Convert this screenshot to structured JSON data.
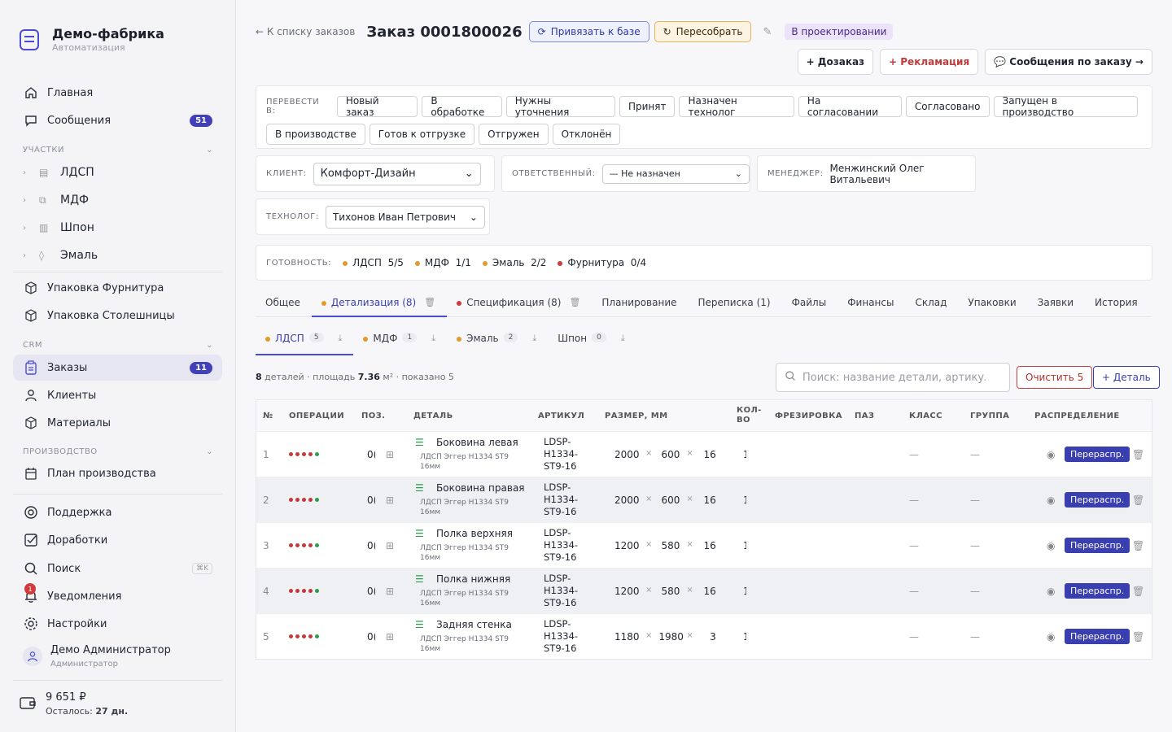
{
  "sidebar": {
    "brand_title": "Демо-фабрика",
    "brand_sub": "Автоматизация",
    "home": "Главная",
    "messages": "Сообщения",
    "messages_badge": "51",
    "section_sites": "УЧАСТКИ",
    "sites": [
      "ЛДСП",
      "МДФ",
      "Шпон",
      "Эмаль"
    ],
    "pack_hardware": "Упаковка Фурнитура",
    "pack_tops": "Упаковка Столешницы",
    "section_crm": "CRM",
    "orders": "Заказы",
    "orders_badge": "11",
    "clients": "Клиенты",
    "materials": "Материалы",
    "section_prod": "ПРОИЗВОДСТВО",
    "plan": "План производства",
    "support": "Поддержка",
    "improvements": "Доработки",
    "search": "Поиск",
    "search_kbd": "⌘K",
    "notifications": "Уведомления",
    "notif_count": "1",
    "settings": "Настройки",
    "user_name": "Демо Администратор",
    "user_role": "Администратор",
    "balance": "9 651 ₽",
    "remaining_label": "Осталось:",
    "remaining_value": "27 дн."
  },
  "header": {
    "back": "← К списку заказов",
    "title": "Заказ 0001800026",
    "bind_btn": "Привязать к базе",
    "rebuild_btn": "Пересобрать",
    "status": "В проектировании",
    "extra_order": "+ Дозаказ",
    "claim": "+ Рекламация",
    "order_messages": "💬 Сообщения по заказу →"
  },
  "transfer": {
    "label": "ПЕРЕВЕСТИ В:",
    "row1": [
      "Новый заказ",
      "В обработке",
      "Нужны уточнения",
      "Принят",
      "Назначен технолог",
      "На согласовании",
      "Согласовано",
      "Запущен в производство"
    ],
    "row2": [
      "В производстве",
      "Готов к отгрузке",
      "Отгружен",
      "Отклонён"
    ]
  },
  "fields": {
    "client_label": "КЛИЕНТ:",
    "client_value": "Комфорт-Дизайн",
    "resp_label": "ОТВЕТСТВЕННЫЙ:",
    "resp_value": "— Не назначен",
    "manager_label": "МЕНЕДЖЕР:",
    "manager_value": "Менжинский Олег Витальевич",
    "tech_label": "ТЕХНОЛОГ:",
    "tech_value": "Тихонов Иван Петрович"
  },
  "readiness": {
    "label": "ГОТОВНОСТЬ:",
    "items": [
      {
        "name": "ЛДСП",
        "value": "5/5",
        "color": "#e39a2a"
      },
      {
        "name": "МДФ",
        "value": "1/1",
        "color": "#e39a2a"
      },
      {
        "name": "Эмаль",
        "value": "2/2",
        "color": "#e39a2a"
      },
      {
        "name": "Фурнитура",
        "value": "0/4",
        "color": "#d23b3b"
      }
    ]
  },
  "tabs": [
    "Общее",
    "Детализация (8)",
    "Спецификация (8)",
    "Планирование",
    "Переписка (1)",
    "Файлы",
    "Финансы",
    "Склад",
    "Упаковки",
    "Заявки",
    "История"
  ],
  "subtabs": [
    {
      "name": "ЛДСП",
      "count": "5"
    },
    {
      "name": "МДФ",
      "count": "1"
    },
    {
      "name": "Эмаль",
      "count": "2"
    },
    {
      "name": "Шпон",
      "count": "0"
    }
  ],
  "summary": {
    "count": "8",
    "count_text": "деталей · площадь",
    "area": "7.36",
    "area_unit": "м²",
    "shown": "· показано 5"
  },
  "search_placeholder": "Поиск: название детали, артикул",
  "clear_btn": "Очистить 5",
  "add_btn": "+ Деталь",
  "columns": [
    "№",
    "ОПЕРАЦИИ",
    "ПОЗ.",
    "ДЕТАЛЬ",
    "АРТИКУЛ",
    "РАЗМЕР, ММ",
    "КОЛ-ВО",
    "ФРЕЗИРОВКА",
    "ПАЗ",
    "КЛАСС",
    "ГРУППА",
    "РАСПРЕДЕЛЕНИЕ"
  ],
  "rows": [
    {
      "n": "1",
      "pos": "0(",
      "name": "Боковина левая",
      "mat": "ЛДСП Эггер H1334 ST9",
      "thick": "16мм",
      "art1": "LDSP-",
      "art2": "H1334-",
      "art3": "ST9-16",
      "l": "2000",
      "w": "600",
      "t": "16",
      "q": "1",
      "cls": "—",
      "grp": "—",
      "btn": "Перераспр."
    },
    {
      "n": "2",
      "pos": "0(",
      "name": "Боковина правая",
      "mat": "ЛДСП Эггер H1334 ST9",
      "thick": "16мм",
      "art1": "LDSP-",
      "art2": "H1334-",
      "art3": "ST9-16",
      "l": "2000",
      "w": "600",
      "t": "16",
      "q": "1",
      "cls": "—",
      "grp": "—",
      "btn": "Перераспр."
    },
    {
      "n": "3",
      "pos": "0(",
      "name": "Полка верхняя",
      "mat": "ЛДСП Эггер H1334 ST9",
      "thick": "16мм",
      "art1": "LDSP-",
      "art2": "H1334-",
      "art3": "ST9-16",
      "l": "1200",
      "w": "580",
      "t": "16",
      "q": "1",
      "cls": "—",
      "grp": "—",
      "btn": "Перераспр."
    },
    {
      "n": "4",
      "pos": "0(",
      "name": "Полка нижняя",
      "mat": "ЛДСП Эггер H1334 ST9",
      "thick": "16мм",
      "art1": "LDSP-",
      "art2": "H1334-",
      "art3": "ST9-16",
      "l": "1200",
      "w": "580",
      "t": "16",
      "q": "1",
      "cls": "—",
      "grp": "—",
      "btn": "Перераспр."
    },
    {
      "n": "5",
      "pos": "0(",
      "name": "Задняя стенка",
      "mat": "ЛДСП Эггер H1334 ST9",
      "thick": "16мм",
      "art1": "LDSP-",
      "art2": "H1334-",
      "art3": "ST9-16",
      "l": "1180",
      "w": "1980",
      "t": "3",
      "q": "1",
      "cls": "—",
      "grp": "—",
      "btn": "Перераспр."
    }
  ]
}
